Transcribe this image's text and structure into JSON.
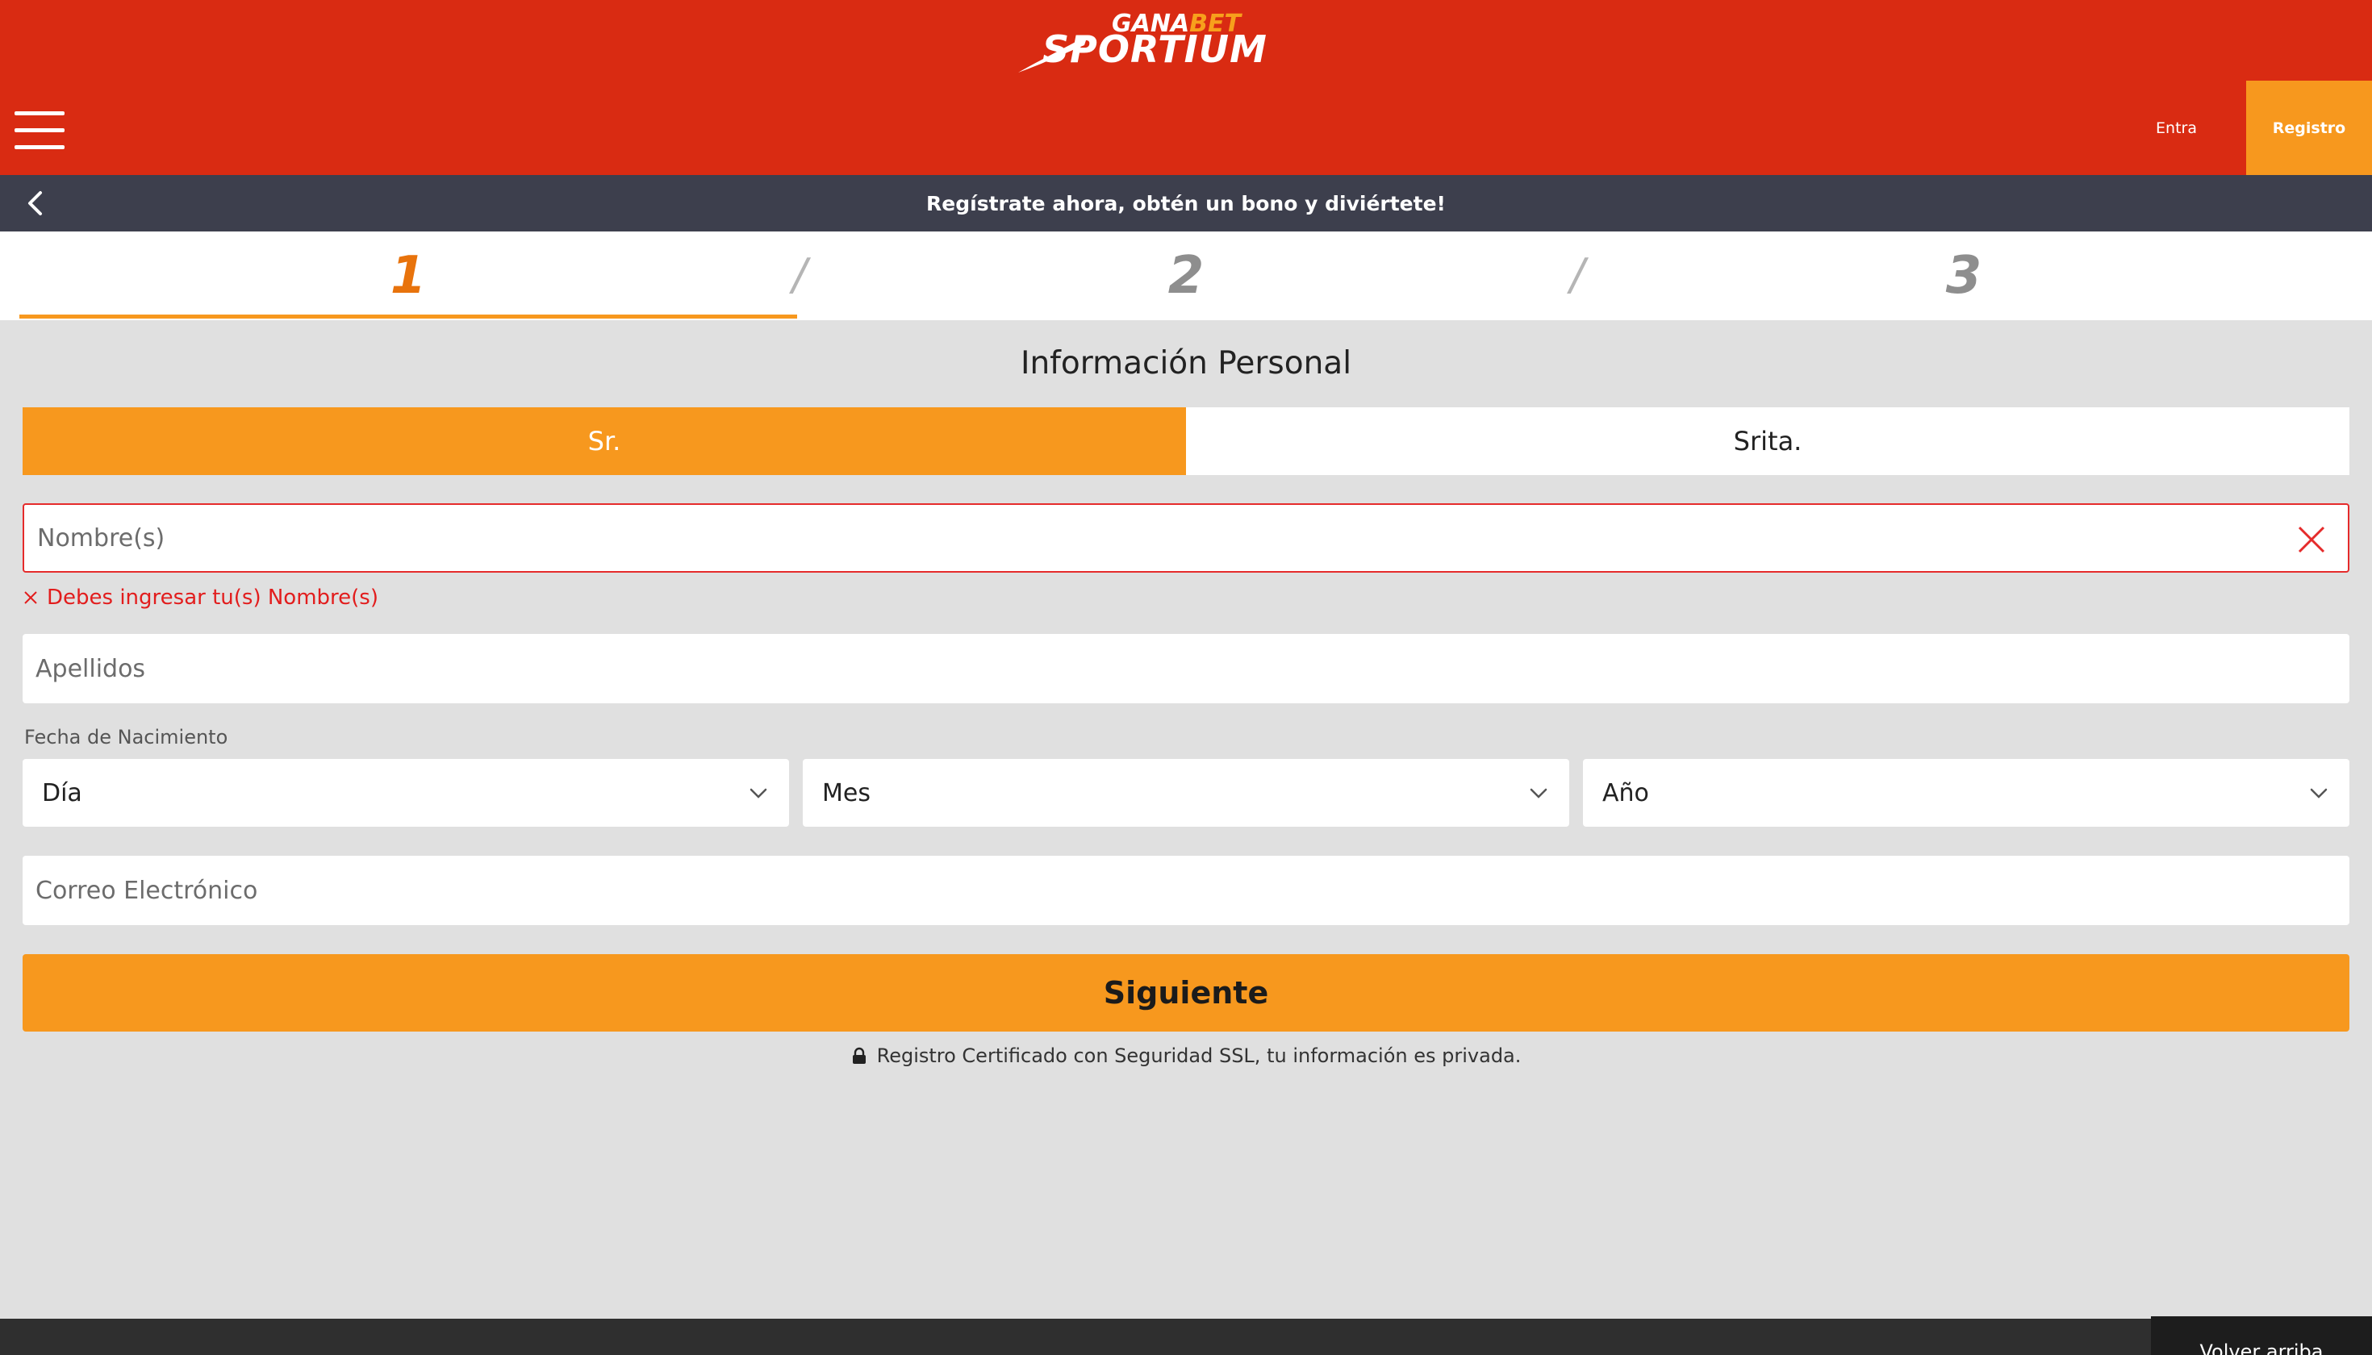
{
  "brand": {
    "logo_top": "GANA",
    "logo_top_accent": "BET",
    "logo_main": "SPORTIUM"
  },
  "nav": {
    "menu_icon": "hamburger-menu-icon",
    "login_label": "Entra",
    "register_label": "Registro"
  },
  "subheader": {
    "back_icon": "chevron-left-icon",
    "title": "Regístrate ahora, obtén un bono y diviértete!"
  },
  "steps": {
    "items": [
      "1",
      "2",
      "3"
    ],
    "separator": "/",
    "active_index": 0
  },
  "form": {
    "section_title": "Información Personal",
    "gender": {
      "options": [
        "Sr.",
        "Srita."
      ],
      "selected": "Sr."
    },
    "first_name": {
      "placeholder": "Nombre(s)",
      "value": "",
      "error": "Debes ingresar tu(s) Nombre(s)"
    },
    "last_name": {
      "placeholder": "Apellidos",
      "value": ""
    },
    "dob": {
      "label": "Fecha de Nacimiento",
      "day": "Día",
      "month": "Mes",
      "year": "Año"
    },
    "email": {
      "placeholder": "Correo Electrónico",
      "value": ""
    },
    "next_label": "Siguiente",
    "ssl_note": "Registro Certificado con Seguridad SSL, tu información es privada."
  },
  "footer": {
    "back_to_top": "Volver arriba"
  },
  "colors": {
    "brand_red": "#d92b12",
    "accent_orange": "#f7981e",
    "step_active": "#e8730c",
    "dark_bar": "#3d3f4d",
    "error_red": "#e21d1d",
    "page_bg": "#e0e0e0"
  }
}
